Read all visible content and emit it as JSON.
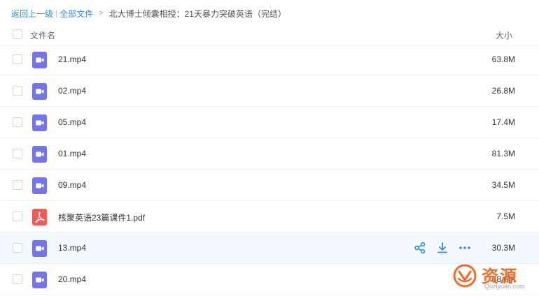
{
  "breadcrumb": {
    "back": "返回上一级",
    "separator": "|",
    "all_files": "全部文件",
    "arrow": ">",
    "current": "北大博士倾囊相授：21天暴力突破英语（完结）"
  },
  "header": {
    "name_label": "文件名",
    "size_label": "大小"
  },
  "files": [
    {
      "name": "21.mp4",
      "size": "63.8M",
      "type": "video"
    },
    {
      "name": "02.mp4",
      "size": "26.8M",
      "type": "video"
    },
    {
      "name": "05.mp4",
      "size": "17.4M",
      "type": "video"
    },
    {
      "name": "01.mp4",
      "size": "81.3M",
      "type": "video"
    },
    {
      "name": "09.mp4",
      "size": "34.5M",
      "type": "video"
    },
    {
      "name": "核聚英语23篇课件1.pdf",
      "size": "7.5M",
      "type": "pdf"
    },
    {
      "name": "13.mp4",
      "size": "30.3M",
      "type": "video",
      "hovered": true
    },
    {
      "name": "20.mp4",
      "size": "68.6M",
      "type": "video"
    }
  ],
  "row_actions": [
    "share-icon",
    "download-icon",
    "more-icon"
  ],
  "watermark": {
    "text": "资源",
    "url": "Quziyuan.com"
  },
  "colors": {
    "link": "#2f8de4",
    "video_icon": "#7475e8",
    "pdf_icon": "#f25a57",
    "action": "#2f8de4",
    "watermark": "#f26b2a"
  }
}
